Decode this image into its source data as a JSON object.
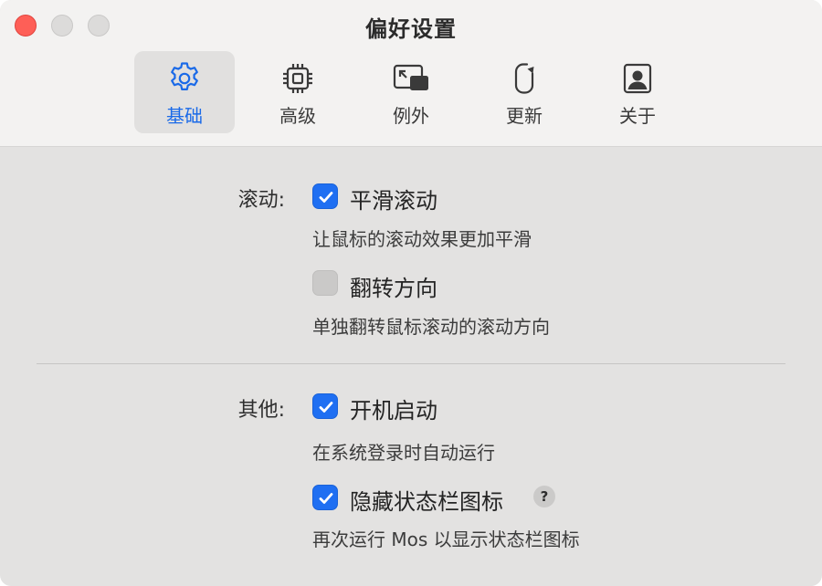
{
  "window": {
    "title": "偏好设置",
    "traffic_lights": [
      "close",
      "minimize",
      "zoom"
    ]
  },
  "tabs": [
    {
      "label": "基础",
      "icon": "gear-icon",
      "active": true
    },
    {
      "label": "高级",
      "icon": "cpu-chip-icon",
      "active": false
    },
    {
      "label": "例外",
      "icon": "window-exception-icon",
      "active": false
    },
    {
      "label": "更新",
      "icon": "refresh-icon",
      "active": false
    },
    {
      "label": "关于",
      "icon": "person-card-icon",
      "active": false
    }
  ],
  "sections": {
    "scroll": {
      "label": "滚动:",
      "options": [
        {
          "label": "平滑滚动",
          "description": "让鼠标的滚动效果更加平滑",
          "checked": true
        },
        {
          "label": "翻转方向",
          "description": "单独翻转鼠标滚动的滚动方向",
          "checked": false
        }
      ]
    },
    "other": {
      "label": "其他:",
      "options": [
        {
          "label": "开机启动",
          "description": "在系统登录时自动运行",
          "checked": true
        },
        {
          "label": "隐藏状态栏图标",
          "description": "再次运行 Mos 以显示状态栏图标",
          "checked": true,
          "help": "?"
        }
      ]
    }
  },
  "colors": {
    "accent": "#1f6ff2",
    "close": "#fe5f57",
    "background": "#e3e2e1",
    "toolbar": "#f3f2f1"
  }
}
